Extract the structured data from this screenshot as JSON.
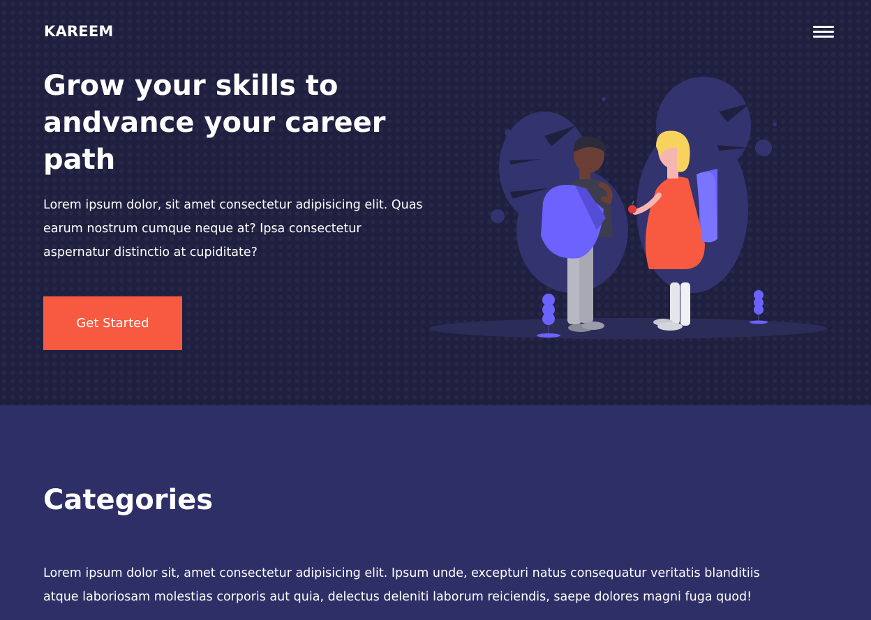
{
  "navbar": {
    "brand": "KAREEM",
    "menu_icon": "hamburger-menu-icon"
  },
  "hero": {
    "title": "Grow your skills to andvance your career path",
    "description": "Lorem ipsum dolor, sit amet consectetur adipisicing elit. Quas earum nostrum cumque neque at? Ipsa consectetur aspernatur distinctio at cupiditate?",
    "cta_label": "Get Started",
    "illustration": "students-with-backpacks-illustration"
  },
  "categories": {
    "title": "Categories",
    "description": "Lorem ipsum dolor sit, amet consectetur adipisicing elit. Ipsum unde, excepturi natus consequatur veritatis blanditiis atque laboriosam molestias corporis aut quia, delectus deleniti laborum reiciendis, saepe dolores magni fuga quod!"
  },
  "colors": {
    "hero_background": "#1f2040",
    "categories_background": "#2f2f67",
    "accent": "#f75a41",
    "illustration_purple": "#6c63ff",
    "text": "#ffffff"
  }
}
